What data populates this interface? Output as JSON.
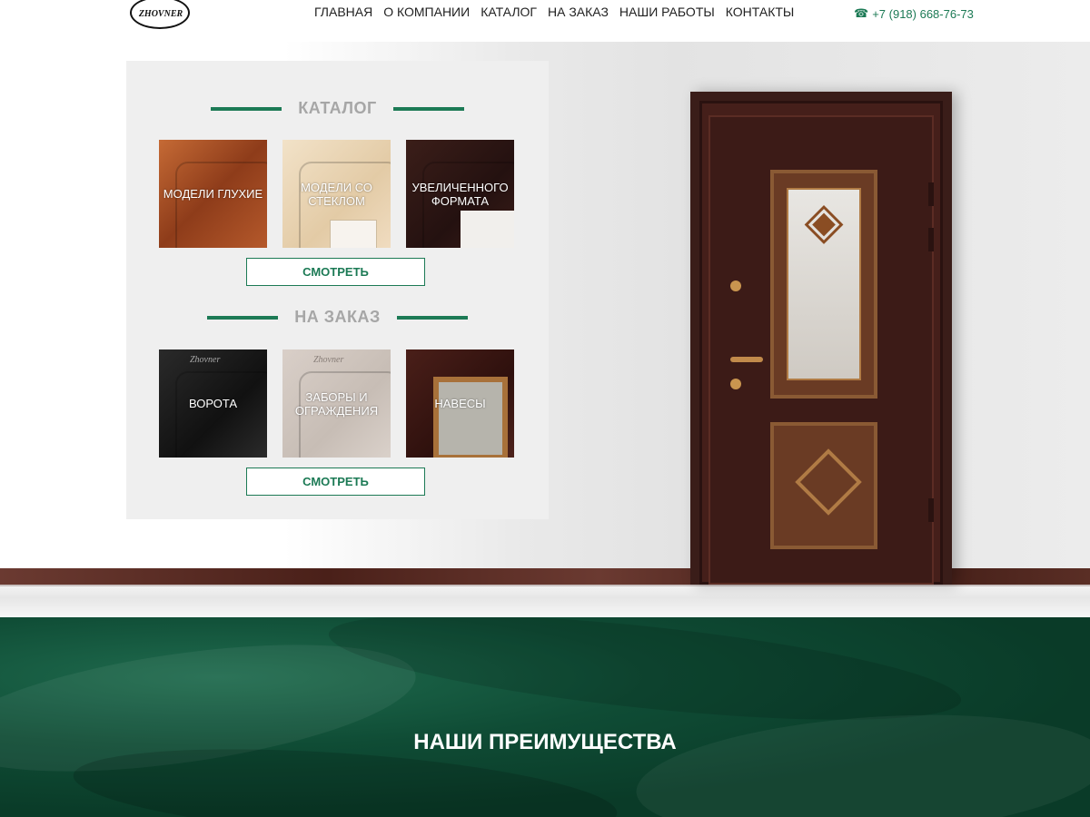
{
  "header": {
    "logo_text": "ZHOVNER",
    "nav": [
      "ГЛАВНАЯ",
      "О КОМПАНИИ",
      "КАТАЛОГ",
      "НА ЗАКАЗ",
      "НАШИ РАБОТЫ",
      "КОНТАКТЫ"
    ],
    "phone": "+7 (918) 668-76-73",
    "phone_icon": "phone-icon"
  },
  "catalog": {
    "title": "КАТАЛОГ",
    "tiles": [
      "МОДЕЛИ ГЛУХИЕ",
      "МОДЕЛИ СО СТЕКЛОМ",
      "УВЕЛИЧЕННОГО ФОРМАТА"
    ],
    "button": "СМОТРЕТЬ"
  },
  "custom": {
    "title": "НА ЗАКАЗ",
    "tiles": [
      "ВОРОТА",
      "ЗАБОРЫ И ОГРАЖДЕНИЯ",
      "НАВЕСЫ"
    ],
    "tile_mark": "Zhovner",
    "button": "СМОТРЕТЬ"
  },
  "advantages": {
    "title": "НАШИ ПРЕИМУЩЕСТВА"
  },
  "colors": {
    "accent": "#1c7a55",
    "advantages_bg": "#0f4c35"
  }
}
